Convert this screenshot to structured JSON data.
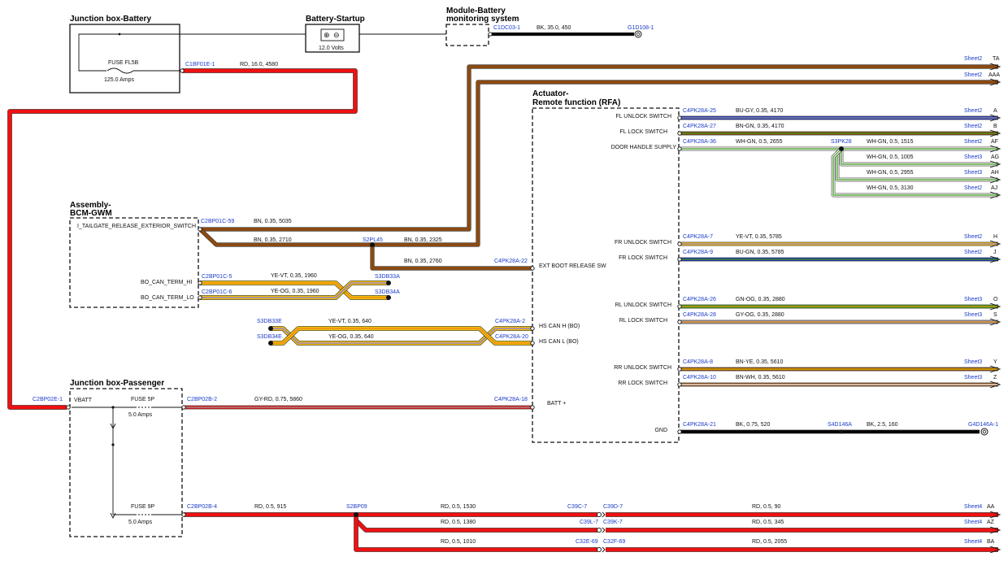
{
  "components": {
    "jb_battery": {
      "title": "Junction box-Battery",
      "fuse_name": "FUSE FL5B",
      "fuse_rating": "125.0 Amps"
    },
    "battery": {
      "title": "Battery-Startup",
      "voltage": "12.0 Volts"
    },
    "bms": {
      "title_line1": "Module-Battery",
      "title_line2": "monitoring system"
    },
    "bcm": {
      "title_line1": "Assembly-",
      "title_line2": "BCM-GWM",
      "pin1": "I_TAILGATE_RELEASE_EXTERIOR_SWITCH",
      "pin2": "BO_CAN_TERM_HI",
      "pin3": "BO_CAN_TERM_LO"
    },
    "rfa": {
      "title_line1": "Actuator-",
      "title_line2": "Remote function (RFA)",
      "pins": [
        "FL UNLOCK SWITCH",
        "FL LOCK SWITCH",
        "DOOR HANDLE SUPPLY",
        "FR UNLOCK SWITCH",
        "FR LOCK SWITCH",
        "EXT BOOT RELEASE SW",
        "HS CAN H (BO)",
        "HS CAN L (BO)",
        "RL UNLOCK SWITCH",
        "RL LOCK SWITCH",
        "RR UNLOCK SWITCH",
        "RR LOCK SWITCH",
        "BATT +",
        "GND"
      ]
    },
    "jb_passenger": {
      "title": "Junction box-Passenger",
      "pin_label": "VBATT",
      "fuse1_name": "FUSE 5P",
      "fuse1_rating": "5.0 Amps",
      "fuse2_name": "FUSE 9P",
      "fuse2_rating": "5.0 Amps"
    }
  },
  "connectors": [
    "C1DC03-1",
    "G1D108-1",
    "C1BF01E-1",
    "C2BP01C-59",
    "S2PL45",
    "C4PK28A-22",
    "C2BP01C-5",
    "C2BP01C-6",
    "S3DB33A",
    "S3DB34A",
    "S3DB33E",
    "S3DB34E",
    "C4PK28A-2",
    "C4PK28A-20",
    "C4PK28A-25",
    "C4PK28A-27",
    "C4PK28A-36",
    "S3PK28",
    "C4PK28A-7",
    "C4PK28A-9",
    "C4PK28A-26",
    "C4PK28A-28",
    "C4PK28A-8",
    "C4PK28A-10",
    "C4PK28A-21",
    "S4D146A",
    "G4D146A-1",
    "C2BP02E-1",
    "C2BP02B-2",
    "C4PK28A-18",
    "C2BP02B-4",
    "S2BP09",
    "C39C-7",
    "C39D-7",
    "C39L-7",
    "C39K-7",
    "C32E-69",
    "C32F-69"
  ],
  "wires": [
    "BK, 35.0, 450",
    "RD, 16.0, 4580",
    "BN, 0.35, 5035",
    "BN, 0.35, 2710",
    "BN, 0.35, 2325",
    "BN, 0.35, 2760",
    "YE-VT, 0.35, 1960",
    "YE-OG, 0.35, 1960",
    "YE-VT, 0.35, 640",
    "YE-OG, 0.35, 640",
    "BU-GY, 0.35, 4170",
    "BN-GN, 0.35, 4170",
    "WH-GN, 0.5, 2655",
    "WH-GN, 0.5, 1515",
    "WH-GN, 0.5, 1005",
    "WH-GN, 0.5, 2955",
    "WH-GN, 0.5, 3130",
    "YE-VT, 0.35, 5785",
    "BU-GN, 0.35, 5785",
    "GN-OG, 0.35, 2880",
    "GY-OG, 0.35, 2880",
    "BN-YE, 0.35, 5610",
    "BN-WH, 0.35, 5610",
    "BK, 0.75, 520",
    "BK, 2.5, 160",
    "GY-RD, 0.75, 5860",
    "RD, 0.5, 915",
    "RD, 0.5, 1530",
    "RD, 0.5, 90",
    "RD, 0.5, 1380",
    "RD, 0.5, 345",
    "RD, 0.5, 1010",
    "RD, 0.5, 2055"
  ],
  "sheets": [
    "Sheet2",
    "Sheet3",
    "Sheet4"
  ],
  "targets": [
    "TA",
    "AAA",
    "A",
    "B",
    "AF",
    "AG",
    "AH",
    "AJ",
    "H",
    "J",
    "O",
    "S",
    "Y",
    "Z",
    "AA",
    "AZ",
    "BA"
  ],
  "colors": {
    "BK": "#000000",
    "RD": "#ee1111",
    "BN": "#8b4a12",
    "YE": "#f2c200",
    "VT": "#9a7fd0",
    "OG": "#f08a1c",
    "BU": "#2233bb",
    "GY": "#999999",
    "GN": "#3a9c16",
    "WH": "#ffffff",
    "connector_text": "#1a3cc8"
  }
}
